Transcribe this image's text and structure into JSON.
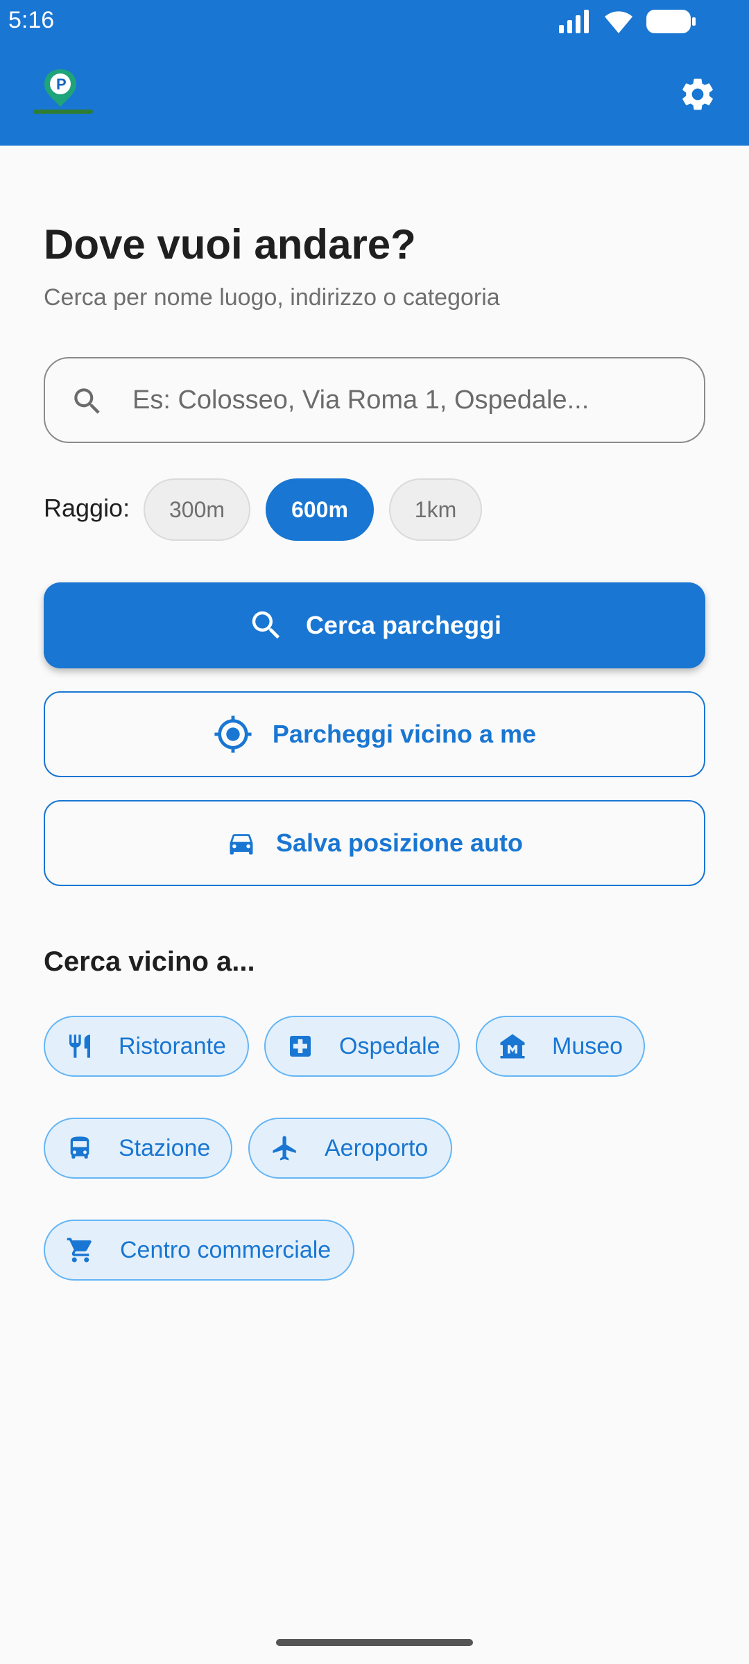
{
  "status_bar": {
    "time": "5:16"
  },
  "colors": {
    "primary": "#1976d2",
    "chip_bg": "#e3f0fb",
    "chip_border": "#64b5f6"
  },
  "header": {
    "logo_icon": "parking-pin-logo-icon",
    "settings_icon": "gear-icon"
  },
  "main": {
    "title": "Dove vuoi andare?",
    "subtitle": "Cerca per nome luogo, indirizzo o categoria",
    "search": {
      "placeholder": "Es: Colosseo, Via Roma 1, Ospedale...",
      "value": ""
    },
    "radius": {
      "label": "Raggio:",
      "options": [
        "300m",
        "600m",
        "1km"
      ],
      "selected": "600m"
    },
    "buttons": {
      "search_parking": "Cerca parcheggi",
      "nearby_parking": "Parcheggi vicino a me",
      "save_car": "Salva posizione auto"
    },
    "nearby_section": {
      "title": "Cerca vicino a...",
      "categories": [
        {
          "label": "Ristorante",
          "icon": "restaurant-icon"
        },
        {
          "label": "Ospedale",
          "icon": "hospital-icon"
        },
        {
          "label": "Museo",
          "icon": "museum-icon"
        },
        {
          "label": "Stazione",
          "icon": "train-icon"
        },
        {
          "label": "Aeroporto",
          "icon": "airplane-icon"
        },
        {
          "label": "Centro commerciale",
          "icon": "shopping-cart-icon"
        }
      ]
    }
  }
}
